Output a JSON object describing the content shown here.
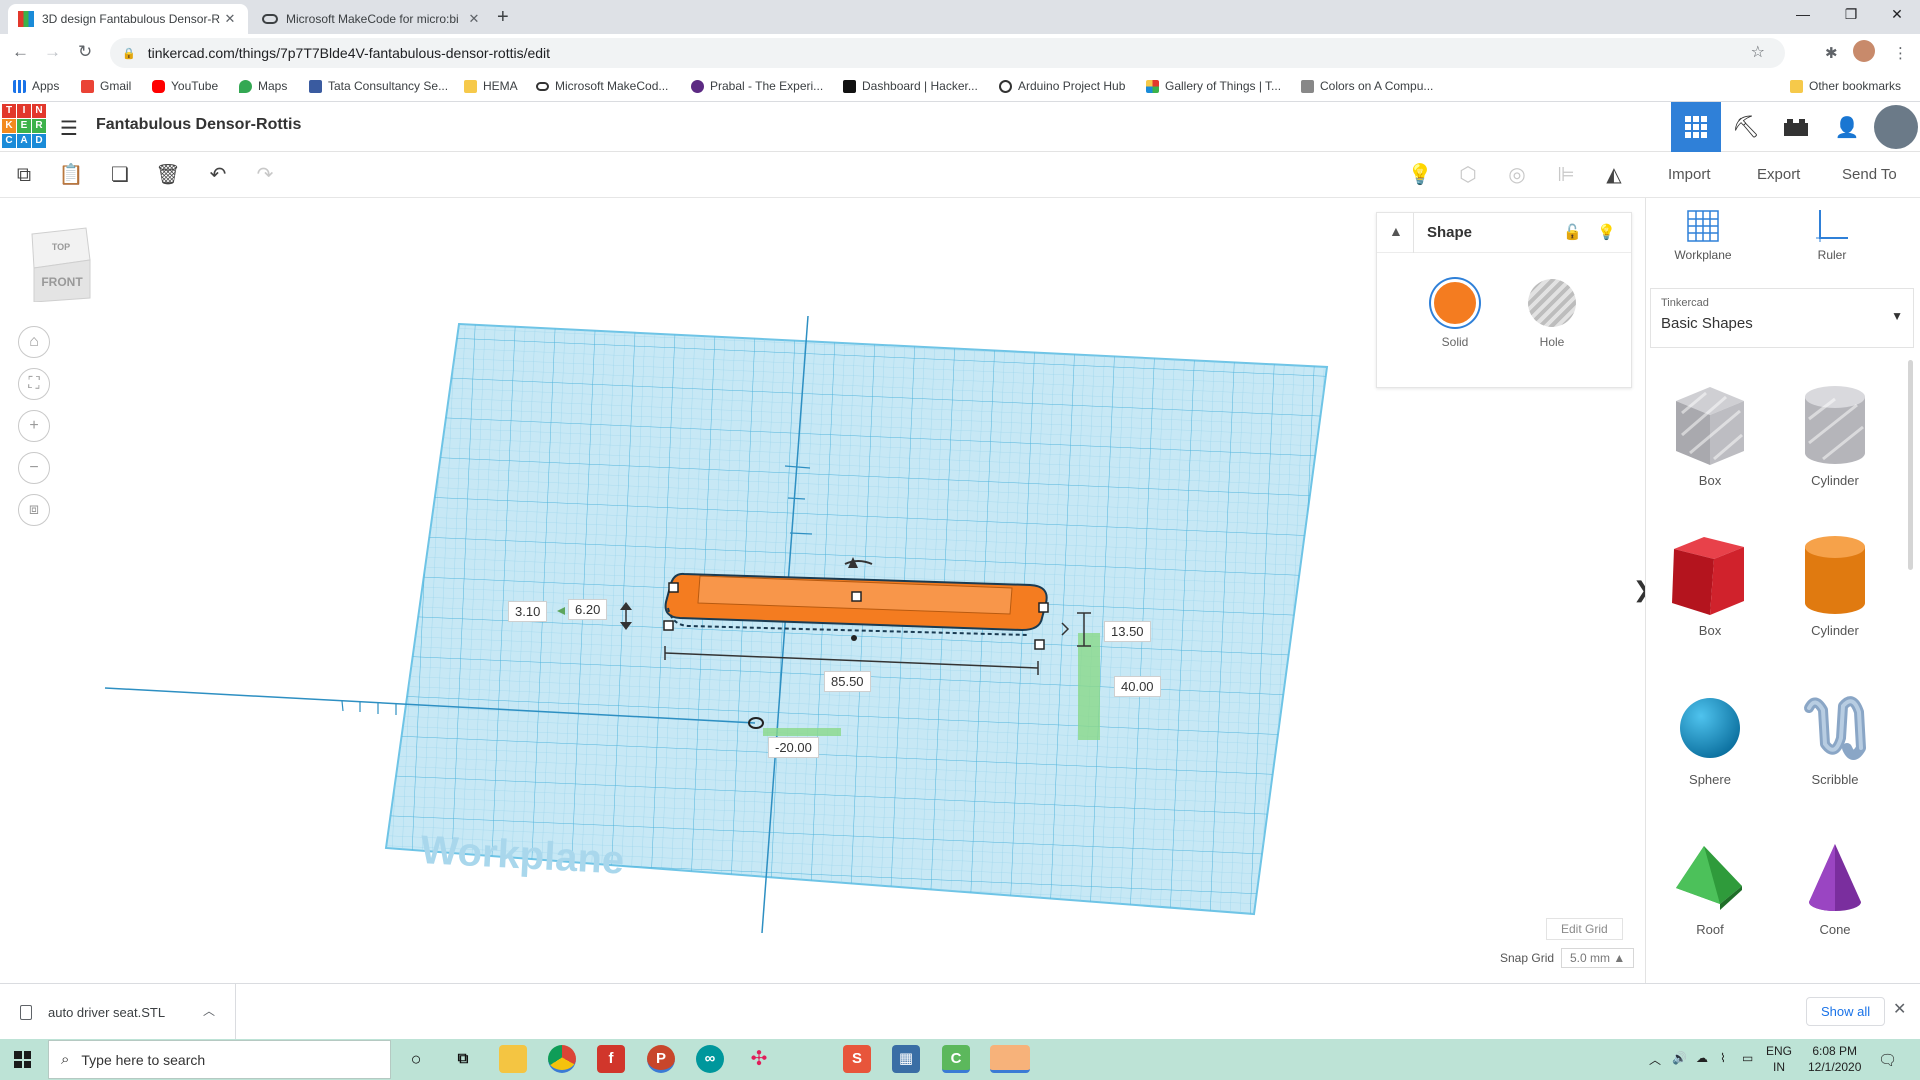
{
  "browser": {
    "tabs": [
      {
        "title": "3D design Fantabulous Densor-R",
        "active": true
      },
      {
        "title": "Microsoft MakeCode for micro:bi",
        "active": false
      }
    ],
    "url": "tinkercad.com/things/7p7T7Blde4V-fantabulous-densor-rottis/edit",
    "bookmarks": [
      "Apps",
      "Gmail",
      "YouTube",
      "Maps",
      "Tata Consultancy Se...",
      "HEMA",
      "Microsoft MakeCod...",
      "Prabal - The Experi...",
      "Dashboard | Hacker...",
      "Arduino Project Hub",
      "Gallery of Things | T...",
      "Colors on A Compu..."
    ],
    "other_bookmarks": "Other bookmarks"
  },
  "app": {
    "design_title": "Fantabulous Densor-Rottis",
    "logo_letters": [
      "T",
      "I",
      "N",
      "K",
      "E",
      "R",
      "C",
      "A",
      "D"
    ],
    "actions": {
      "import": "Import",
      "export": "Export",
      "send_to": "Send To"
    }
  },
  "viewcube": {
    "top": "TOP",
    "front": "FRONT"
  },
  "workplane_label": "Workplane",
  "dimensions": {
    "elevation": "3.10",
    "height": "6.20",
    "width": "13.50",
    "length": "85.50",
    "y_offset": "40.00",
    "x_offset": "-20.00"
  },
  "snap": {
    "edit_grid": "Edit Grid",
    "label": "Snap Grid",
    "value": "5.0 mm ▲"
  },
  "inspector": {
    "title": "Shape",
    "solid": "Solid",
    "hole": "Hole",
    "solid_color": "#f47c20"
  },
  "rightpanel": {
    "workplane": "Workplane",
    "ruler": "Ruler",
    "library_provider": "Tinkercad",
    "library_name": "Basic Shapes",
    "shapes": [
      "Box",
      "Cylinder",
      "Box",
      "Cylinder",
      "Sphere",
      "Scribble",
      "Roof",
      "Cone"
    ]
  },
  "downloads": {
    "file": "auto driver seat.STL",
    "show_all": "Show all"
  },
  "taskbar": {
    "search_placeholder": "Type here to search",
    "lang": "ENG",
    "region": "IN",
    "time": "6:08 PM",
    "date": "12/1/2020"
  }
}
